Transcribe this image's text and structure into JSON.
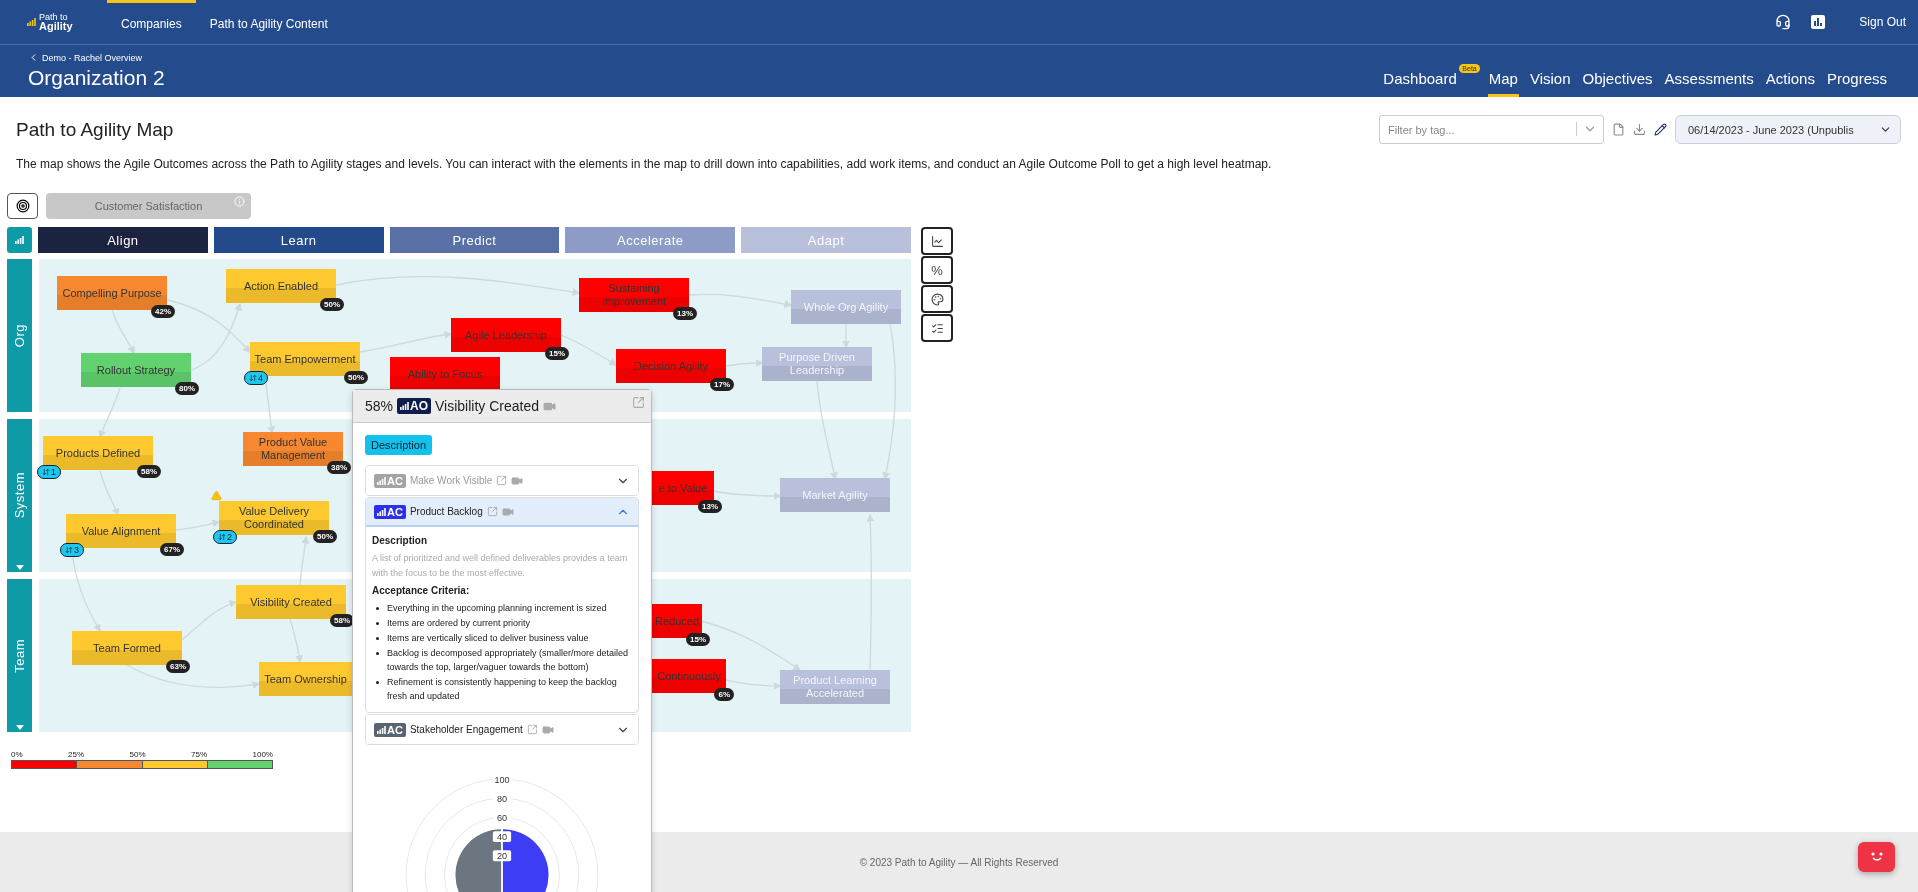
{
  "topbar": {
    "logo": "Path to **Agility**",
    "nav": [
      {
        "label": "Companies",
        "selected": true
      },
      {
        "label": "Path to Agility Content",
        "selected": false
      }
    ],
    "sign_out": "Sign Out"
  },
  "org_bar": {
    "breadcrumb": "Demo - Rachel Overview",
    "title": "Organization 2",
    "tabs": [
      {
        "label": "Dashboard",
        "badge": "Beta",
        "selected": false
      },
      {
        "label": "Map",
        "selected": true
      },
      {
        "label": "Vision",
        "selected": false
      },
      {
        "label": "Objectives",
        "selected": false
      },
      {
        "label": "Assessments",
        "selected": false
      },
      {
        "label": "Actions",
        "selected": false
      },
      {
        "label": "Progress",
        "selected": false
      }
    ]
  },
  "page": {
    "title": "Path to Agility Map",
    "filter": {
      "placeholder": "Filter by tag..."
    },
    "period": "06/14/2023 - June 2023 (Unpublis",
    "description": "The map shows the Agile Outcomes across the Path to Agility stages and levels. You can interact with the elements in the map to drill down into capabilities, add work items, and conduct an Agile Outcome Poll to get a high level heatmap."
  },
  "focus": {
    "label": "Customer Satisfaction"
  },
  "stages": [
    {
      "label": "Align",
      "color": "#1b2340"
    },
    {
      "label": "Learn",
      "color": "#234a8a"
    },
    {
      "label": "Predict",
      "color": "#5870a6"
    },
    {
      "label": "Accelerate",
      "color": "#8d9cc6"
    },
    {
      "label": "Adapt",
      "color": "#b9c0dc"
    }
  ],
  "levels": [
    {
      "label": "Org",
      "toggle": false,
      "nodes": [
        {
          "label": "Compelling Purpose",
          "percent": "42%",
          "color": "#f7882f"
        },
        {
          "label": "Action Enabled",
          "percent": "50%",
          "color": "#fdc92f"
        },
        {
          "label": "Rollout Strategy",
          "percent": "80%",
          "color": "#62d26f"
        },
        {
          "label": "Team Empowerment",
          "percent": "50%",
          "color": "#fdc92f",
          "count": "4"
        },
        {
          "label": "Agile Leadership",
          "percent": "15%",
          "color": "#fe0000"
        },
        {
          "label": "Ability to Focus",
          "color": "#fe0000"
        },
        {
          "label": "Sustaining Improvement",
          "percent": "13%",
          "color": "#fe0000"
        },
        {
          "label": "Decision Agility",
          "percent": "17%",
          "color": "#fe0000"
        },
        {
          "label": "Whole Org Agility",
          "color": "#b9c0dc"
        },
        {
          "label": "Purpose Driven Leadership",
          "color": "#b9c0dc"
        }
      ]
    },
    {
      "label": "System",
      "toggle": true,
      "nodes": [
        {
          "label": "Products Defined",
          "percent": "58%",
          "color": "#fdc92f",
          "count": "1"
        },
        {
          "label": "Product Value Management",
          "percent": "38%",
          "color": "#f7882f"
        },
        {
          "label": "Value Alignment",
          "percent": "67%",
          "color": "#fdc92f",
          "count": "3"
        },
        {
          "label": "Value Delivery Coordinated",
          "percent": "50%",
          "color": "#fdc92f",
          "count": "2",
          "warning": true
        },
        {
          "label": "e to Value",
          "percent": "13%",
          "color": "#fe0000"
        },
        {
          "label": "Market Agility",
          "color": "#b9c0dc"
        }
      ]
    },
    {
      "label": "Team",
      "toggle": true,
      "nodes": [
        {
          "label": "Visibility Created",
          "percent": "58%",
          "color": "#fdc92f"
        },
        {
          "label": "Team Formed",
          "percent": "63%",
          "color": "#fdc92f"
        },
        {
          "label": "Team Ownership",
          "color": "#fdc92f"
        },
        {
          "label": "Reduced",
          "percent": "15%",
          "color": "#fe0000"
        },
        {
          "label": "Continuously",
          "percent": "6%",
          "color": "#fe0000"
        },
        {
          "label": "Product Learning Accelerated",
          "color": "#b9c0dc"
        }
      ]
    }
  ],
  "tools": [
    {
      "kind": "chart"
    },
    {
      "kind": "percent",
      "label": "%"
    },
    {
      "kind": "palette"
    },
    {
      "kind": "checklist"
    }
  ],
  "legend": {
    "stops": [
      "0%",
      "25%",
      "50%",
      "75%",
      "100%"
    ],
    "segments": [
      {
        "color": "#fe0000"
      },
      {
        "color": "#f7882f"
      },
      {
        "color": "#fdc92f"
      },
      {
        "color": "#62d26f"
      }
    ]
  },
  "popup": {
    "percent": "58%",
    "badge": "AO",
    "title": "Visibility Created",
    "tab": {
      "label": "Description",
      "selected": true
    },
    "capabilities": [
      {
        "badge": "AC",
        "label": "Make Work Visible",
        "color": "#a4a4a4",
        "disabled": true,
        "expanded": false
      },
      {
        "badge": "AC",
        "label": "Product Backlog",
        "color": "#2f2fe8",
        "disabled": false,
        "expanded": true,
        "details": {
          "heading": "Description",
          "text": "A list of prioritized and well defined deliverables provides a team with the focus to be the most effective.",
          "criteria_heading": "Acceptance Criteria:",
          "criteria": [
            "Everything in the upcoming planning increment is sized",
            "Items are ordered by current priority",
            "Items are vertically sliced to deliver business value",
            "Backlog is decomposed appropriately (smaller/more detailed towards the top, larger/vaguer towards the bottom)",
            "Refinement is consistently happening to keep the backlog fresh and updated"
          ]
        }
      },
      {
        "badge": "AC",
        "label": "Stakeholder Engagement",
        "color": "#5a6470",
        "disabled": false,
        "expanded": false
      }
    ],
    "chart": {
      "ticks": [
        "100",
        "80",
        "60",
        "40",
        "20"
      ]
    }
  },
  "footer": "© 2023 Path to Agility — All Rights Reserved"
}
